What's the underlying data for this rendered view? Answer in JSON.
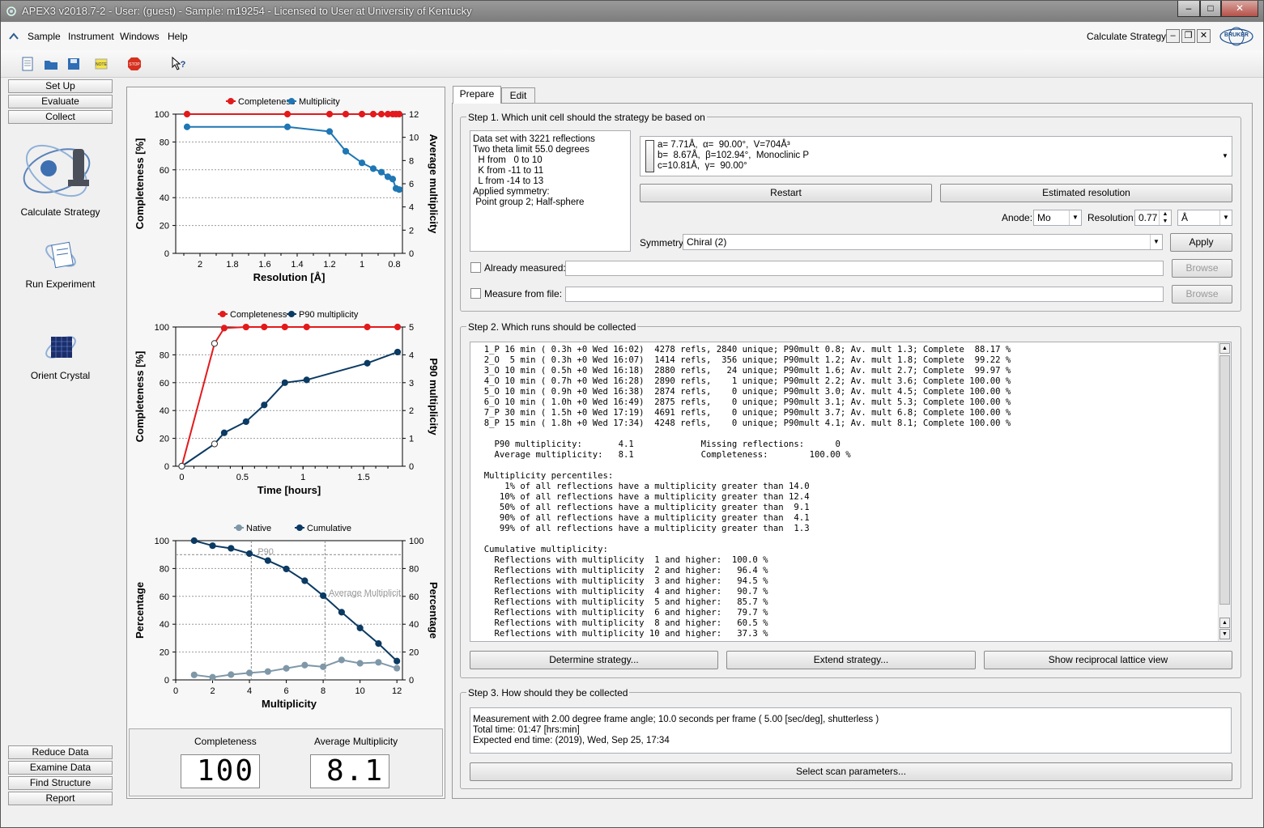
{
  "window": {
    "title": "APEX3 v2018.7-2 - User: (guest) - Sample: m19254 - Licensed to User at University of Kentucky",
    "min": "–",
    "max": "□",
    "close": "✕"
  },
  "menu": [
    "Sample",
    "Instrument",
    "Windows",
    "Help"
  ],
  "mdi": {
    "title": "Calculate Strategy",
    "logo": "BRUKER"
  },
  "sidebar": {
    "top": [
      "Set Up",
      "Evaluate",
      "Collect"
    ],
    "items": [
      "Calculate Strategy",
      "Run Experiment",
      "Orient Crystal"
    ],
    "bottom": [
      "Reduce Data",
      "Examine Data",
      "Find Structure",
      "Report"
    ]
  },
  "chart_data": [
    {
      "type": "line",
      "legend": [
        "Completeness",
        "Multiplicity"
      ],
      "xlabel": "Resolution [Å]",
      "ylabel": "Completeness [%]",
      "y2label": "Average multiplicity",
      "xticks": [
        "2",
        "1.8",
        "1.6",
        "1.4",
        "1.2",
        "1",
        "0.8"
      ],
      "yticks": [
        "0",
        "20",
        "40",
        "60",
        "80",
        "100"
      ],
      "y2ticks": [
        "0",
        "2",
        "4",
        "6",
        "8",
        "10",
        "12"
      ],
      "series": [
        {
          "name": "Completeness",
          "color": "#e31a1c",
          "x": [
            2.08,
            1.46,
            1.2,
            1.1,
            1.0,
            0.93,
            0.88,
            0.84,
            0.81,
            0.79,
            0.77
          ],
          "y": [
            100,
            100,
            100,
            100,
            100,
            100,
            100,
            100,
            100,
            100,
            100
          ]
        },
        {
          "name": "Multiplicity",
          "color": "#1f77b4",
          "x": [
            2.08,
            1.46,
            1.2,
            1.1,
            1.0,
            0.93,
            0.88,
            0.84,
            0.81,
            0.79,
            0.77
          ],
          "y": [
            10.9,
            10.9,
            10.5,
            8.8,
            7.8,
            7.3,
            7.0,
            6.6,
            6.4,
            5.6,
            5.5
          ]
        }
      ]
    },
    {
      "type": "line",
      "legend": [
        "Completeness",
        "P90 multiplicity"
      ],
      "xlabel": "Time [hours]",
      "ylabel": "Completeness [%]",
      "y2label": "P90 multiplicity",
      "xticks": [
        "0",
        "0.5",
        "1",
        "1.5"
      ],
      "yticks": [
        "0",
        "20",
        "40",
        "60",
        "80",
        "100"
      ],
      "y2ticks": [
        "0",
        "1",
        "2",
        "3",
        "4",
        "5"
      ],
      "series": [
        {
          "name": "Completeness",
          "color": "#e31a1c",
          "x": [
            0,
            0.27,
            0.35,
            0.53,
            0.68,
            0.85,
            1.03,
            1.53,
            1.78
          ],
          "y": [
            0,
            88.17,
            99.22,
            99.97,
            100,
            100,
            100,
            100,
            100
          ]
        },
        {
          "name": "P90 multiplicity",
          "color": "#0b3a63",
          "x": [
            0,
            0.27,
            0.35,
            0.53,
            0.68,
            0.85,
            1.03,
            1.53,
            1.78
          ],
          "y": [
            0,
            0.8,
            1.2,
            1.6,
            2.2,
            3.0,
            3.1,
            3.7,
            4.1
          ]
        }
      ]
    },
    {
      "type": "line",
      "legend": [
        "Native",
        "Cumulative"
      ],
      "xlabel": "Multiplicity",
      "ylabel": "Percentage",
      "y2label": "Percentage",
      "xticks": [
        "0",
        "2",
        "4",
        "6",
        "8",
        "10",
        "12"
      ],
      "yticks": [
        "0",
        "20",
        "40",
        "60",
        "80",
        "100"
      ],
      "y2ticks": [
        "0",
        "20",
        "40",
        "60",
        "80",
        "100"
      ],
      "annotations": [
        "P90",
        "Average Multiplicit"
      ],
      "series": [
        {
          "name": "Native",
          "color": "#7f98a8",
          "x": [
            1,
            2,
            3,
            4,
            5,
            6,
            7,
            8,
            9,
            10,
            11,
            12
          ],
          "y": [
            3.6,
            1.9,
            3.8,
            5.0,
            6.0,
            8.3,
            10.6,
            9.4,
            14.3,
            11.9,
            12.6,
            8.4
          ]
        },
        {
          "name": "Cumulative",
          "color": "#0b3a63",
          "x": [
            1,
            2,
            3,
            4,
            5,
            6,
            7,
            8,
            9,
            10,
            11,
            12
          ],
          "y": [
            100.0,
            96.4,
            94.5,
            90.7,
            85.7,
            79.7,
            71.2,
            60.5,
            48.6,
            37.3,
            26.1,
            13.5
          ]
        }
      ]
    }
  ],
  "summary": {
    "completeness_label": "Completeness",
    "completeness_value": "100",
    "avg_mult_label": "Average Multiplicity",
    "avg_mult_value": "8.1"
  },
  "tabs": [
    "Prepare",
    "Edit"
  ],
  "step1": {
    "title": "Step 1. Which unit cell should the strategy be based on",
    "info": [
      "Data set with 3221 reflections",
      "Two theta limit 55.0 degrees",
      "  H from   0 to 10",
      "  K from -11 to 11",
      "  L from -14 to 13",
      "Applied symmetry:",
      " Point group 2; Half-sphere"
    ],
    "cell": [
      "a= 7.71Å,  α=  90.00°,  V=704Å³",
      "b=  8.67Å,  β=102.94°,  Monoclinic P",
      "c=10.81Å,  γ=  90.00°"
    ],
    "restart": "Restart",
    "estimated": "Estimated resolution",
    "anode_label": "Anode:",
    "anode": "Mo",
    "resolution_label": "Resolution:",
    "resolution": "0.77",
    "unit": "Å",
    "symmetry_label": "Symmetry:",
    "symmetry": "Chiral (2)",
    "apply": "Apply",
    "already_measured": "Already measured:",
    "measure_from_file": "Measure from file:",
    "browse": "Browse"
  },
  "step2": {
    "title": "Step 2. Which runs should be collected",
    "lines": [
      "  1_P 16 min ( 0.3h +0 Wed 16:02)  4278 refls, 2840 unique; P90mult 0.8; Av. mult 1.3; Complete  88.17 %",
      "  2_O  5 min ( 0.3h +0 Wed 16:07)  1414 refls,  356 unique; P90mult 1.2; Av. mult 1.8; Complete  99.22 %",
      "  3_O 10 min ( 0.5h +0 Wed 16:18)  2880 refls,   24 unique; P90mult 1.6; Av. mult 2.7; Complete  99.97 %",
      "  4_O 10 min ( 0.7h +0 Wed 16:28)  2890 refls,    1 unique; P90mult 2.2; Av. mult 3.6; Complete 100.00 %",
      "  5_O 10 min ( 0.9h +0 Wed 16:38)  2874 refls,    0 unique; P90mult 3.0; Av. mult 4.5; Complete 100.00 %",
      "  6_O 10 min ( 1.0h +0 Wed 16:49)  2875 refls,    0 unique; P90mult 3.1; Av. mult 5.3; Complete 100.00 %",
      "  7_P 30 min ( 1.5h +0 Wed 17:19)  4691 refls,    0 unique; P90mult 3.7; Av. mult 6.8; Complete 100.00 %",
      "  8_P 15 min ( 1.8h +0 Wed 17:34)  4248 refls,    0 unique; P90mult 4.1; Av. mult 8.1; Complete 100.00 %",
      "",
      "    P90 multiplicity:       4.1             Missing reflections:      0",
      "    Average multiplicity:   8.1             Completeness:        100.00 %",
      "",
      "  Multiplicity percentiles:",
      "      1% of all reflections have a multiplicity greater than 14.0",
      "     10% of all reflections have a multiplicity greater than 12.4",
      "     50% of all reflections have a multiplicity greater than  9.1",
      "     90% of all reflections have a multiplicity greater than  4.1",
      "     99% of all reflections have a multiplicity greater than  1.3",
      "",
      "  Cumulative multiplicity:",
      "    Reflections with multiplicity  1 and higher:  100.0 %",
      "    Reflections with multiplicity  2 and higher:   96.4 %",
      "    Reflections with multiplicity  3 and higher:   94.5 %",
      "    Reflections with multiplicity  4 and higher:   90.7 %",
      "    Reflections with multiplicity  5 and higher:   85.7 %",
      "    Reflections with multiplicity  6 and higher:   79.7 %",
      "    Reflections with multiplicity  8 and higher:   60.5 %",
      "    Reflections with multiplicity 10 and higher:   37.3 %"
    ],
    "determine": "Determine strategy...",
    "extend": "Extend strategy...",
    "reciprocal": "Show reciprocal lattice view"
  },
  "step3": {
    "title": "Step 3. How should they be collected",
    "lines": [
      "Measurement with 2.00 degree frame angle; 10.0 seconds per frame ( 5.00 [sec/deg], shutterless )",
      "Total time: 01:47 [hrs:min]",
      "Expected end time: (2019), Wed, Sep 25,  17:34"
    ],
    "select": "Select scan parameters..."
  }
}
